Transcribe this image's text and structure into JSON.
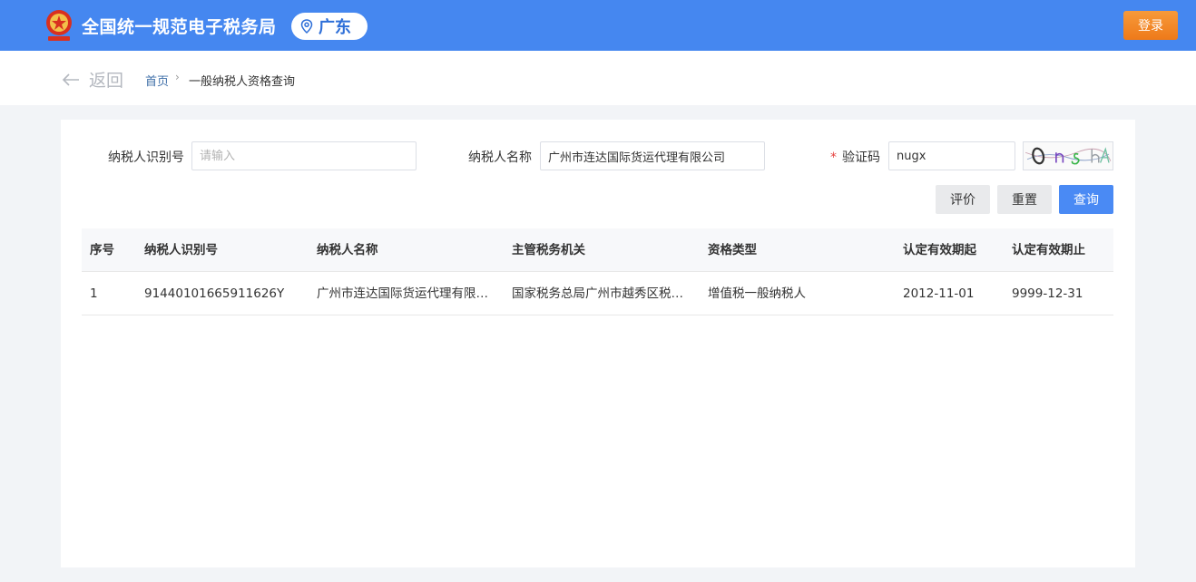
{
  "header": {
    "site_title": "全国统一规范电子税务局",
    "region": "广东",
    "login_label": "登录"
  },
  "breadcrumb": {
    "back_label": "返回",
    "home": "首页",
    "separator": "›",
    "current": "一般纳税人资格查询"
  },
  "form": {
    "taxpayer_id_label": "纳税人识别号",
    "taxpayer_id_placeholder": "请输入",
    "taxpayer_id_value": "",
    "taxpayer_name_label": "纳税人名称",
    "taxpayer_name_value": "广州市连达国际货运代理有限公司",
    "captcha_required_mark": "*",
    "captcha_label": "验证码",
    "captcha_value": "nugx"
  },
  "buttons": {
    "evaluate": "评价",
    "reset": "重置",
    "query": "查询"
  },
  "table": {
    "headers": [
      "序号",
      "纳税人识别号",
      "纳税人名称",
      "主管税务机关",
      "资格类型",
      "认定有效期起",
      "认定有效期止"
    ],
    "rows": [
      [
        "1",
        "91440101665911626Y",
        "广州市连达国际货运代理有限公司",
        "国家税务总局广州市越秀区税务局",
        "增值税一般纳税人",
        "2012-11-01",
        "9999-12-31"
      ]
    ]
  },
  "colors": {
    "header_bg": "#4587f0",
    "login_btn": "#f08a2a",
    "primary_btn": "#4a8af4"
  }
}
